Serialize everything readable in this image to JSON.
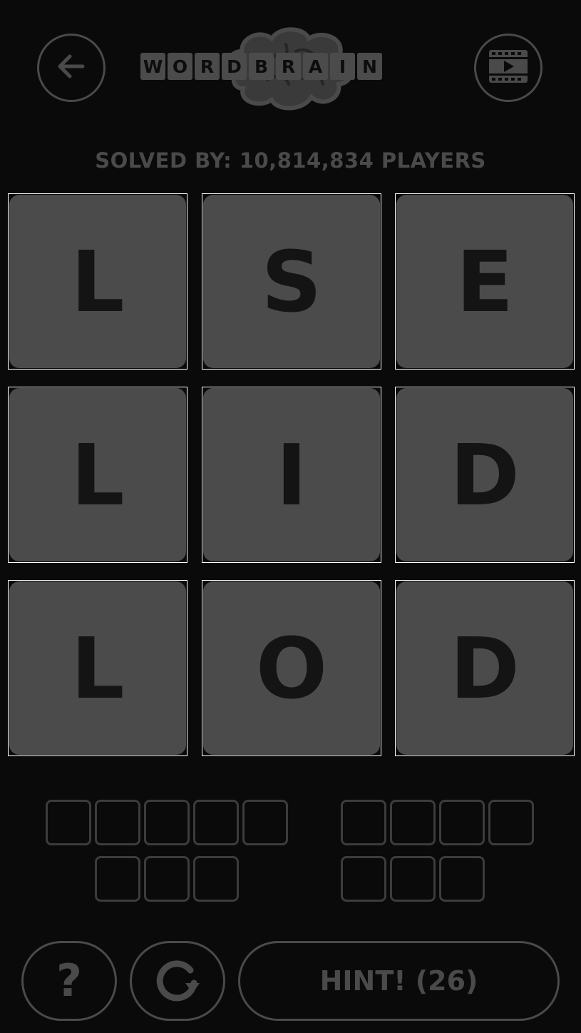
{
  "header": {
    "back_icon": "arrow-left-icon",
    "video_icon": "film-play-icon",
    "logo_letters": [
      "W",
      "O",
      "R",
      "D",
      "B",
      "R",
      "A",
      "I",
      "N"
    ]
  },
  "solved_text": "SOLVED BY: 10,814,834 PLAYERS",
  "grid": {
    "letters": [
      "L",
      "S",
      "E",
      "L",
      "I",
      "D",
      "L",
      "O",
      "D"
    ]
  },
  "answers": {
    "word1_length": 8,
    "word2_length": 7
  },
  "footer": {
    "help_label": "?",
    "reset_icon": "refresh-icon",
    "hint_label": "HINT! (26)"
  },
  "colors": {
    "background": "#0a0a0a",
    "tile": "#4b4b4b",
    "tile_letter": "#141414",
    "outline": "#4a4a4a",
    "tile_border": "#ffffff"
  }
}
